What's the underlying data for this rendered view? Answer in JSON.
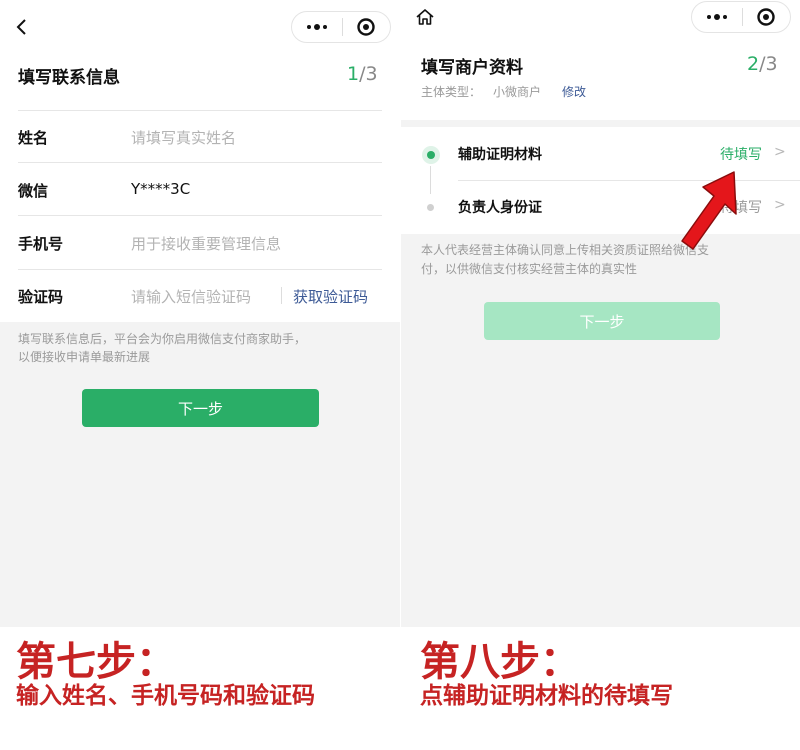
{
  "left": {
    "title": "填写联系信息",
    "step_current": "1",
    "step_total": "/3",
    "fields": [
      {
        "label": "姓名",
        "placeholder": "请填写真实姓名",
        "value": ""
      },
      {
        "label": "微信",
        "placeholder": "",
        "value": "Y****3C"
      },
      {
        "label": "手机号",
        "placeholder": "用于接收重要管理信息",
        "value": ""
      },
      {
        "label": "验证码",
        "placeholder": "请输入短信验证码",
        "value": ""
      }
    ],
    "get_code_label": "获取验证码",
    "notice_line1": "填写联系信息后，平台会为你启用微信支付商家助手，",
    "notice_line2": "以便接收申请单最新进展",
    "next_label": "下一步",
    "caption_title": "第七步：",
    "caption_text": "输入姓名、手机号码和验证码"
  },
  "right": {
    "title": "填写商户资料",
    "step_current": "2",
    "step_total": "/3",
    "subject_label": "主体类型：",
    "subject_value": "小微商户",
    "edit_label": "修改",
    "items": [
      {
        "label": "辅助证明材料",
        "status": "待填写",
        "active": true
      },
      {
        "label": "负责人身份证",
        "status": "待填写",
        "active": false
      }
    ],
    "consent_line1": "本人代表经营主体确认同意上传相关资质证照给微信支",
    "consent_line2": "付，以供微信支付核实经营主体的真实性",
    "next_label": "下一步",
    "caption_title": "第八步：",
    "caption_text": "点辅助证明材料的待填写"
  },
  "colors": {
    "accent": "#2aae67",
    "accent_disabled": "#a6e6c3",
    "link": "#3d5a96",
    "caption_red": "#c62323",
    "arrow_red": "#e4161b"
  },
  "icons": {
    "back": "chevron-left-icon",
    "home": "home-icon",
    "more": "more-dots-icon",
    "close": "target-icon",
    "annotation": "red-arrow-icon"
  }
}
